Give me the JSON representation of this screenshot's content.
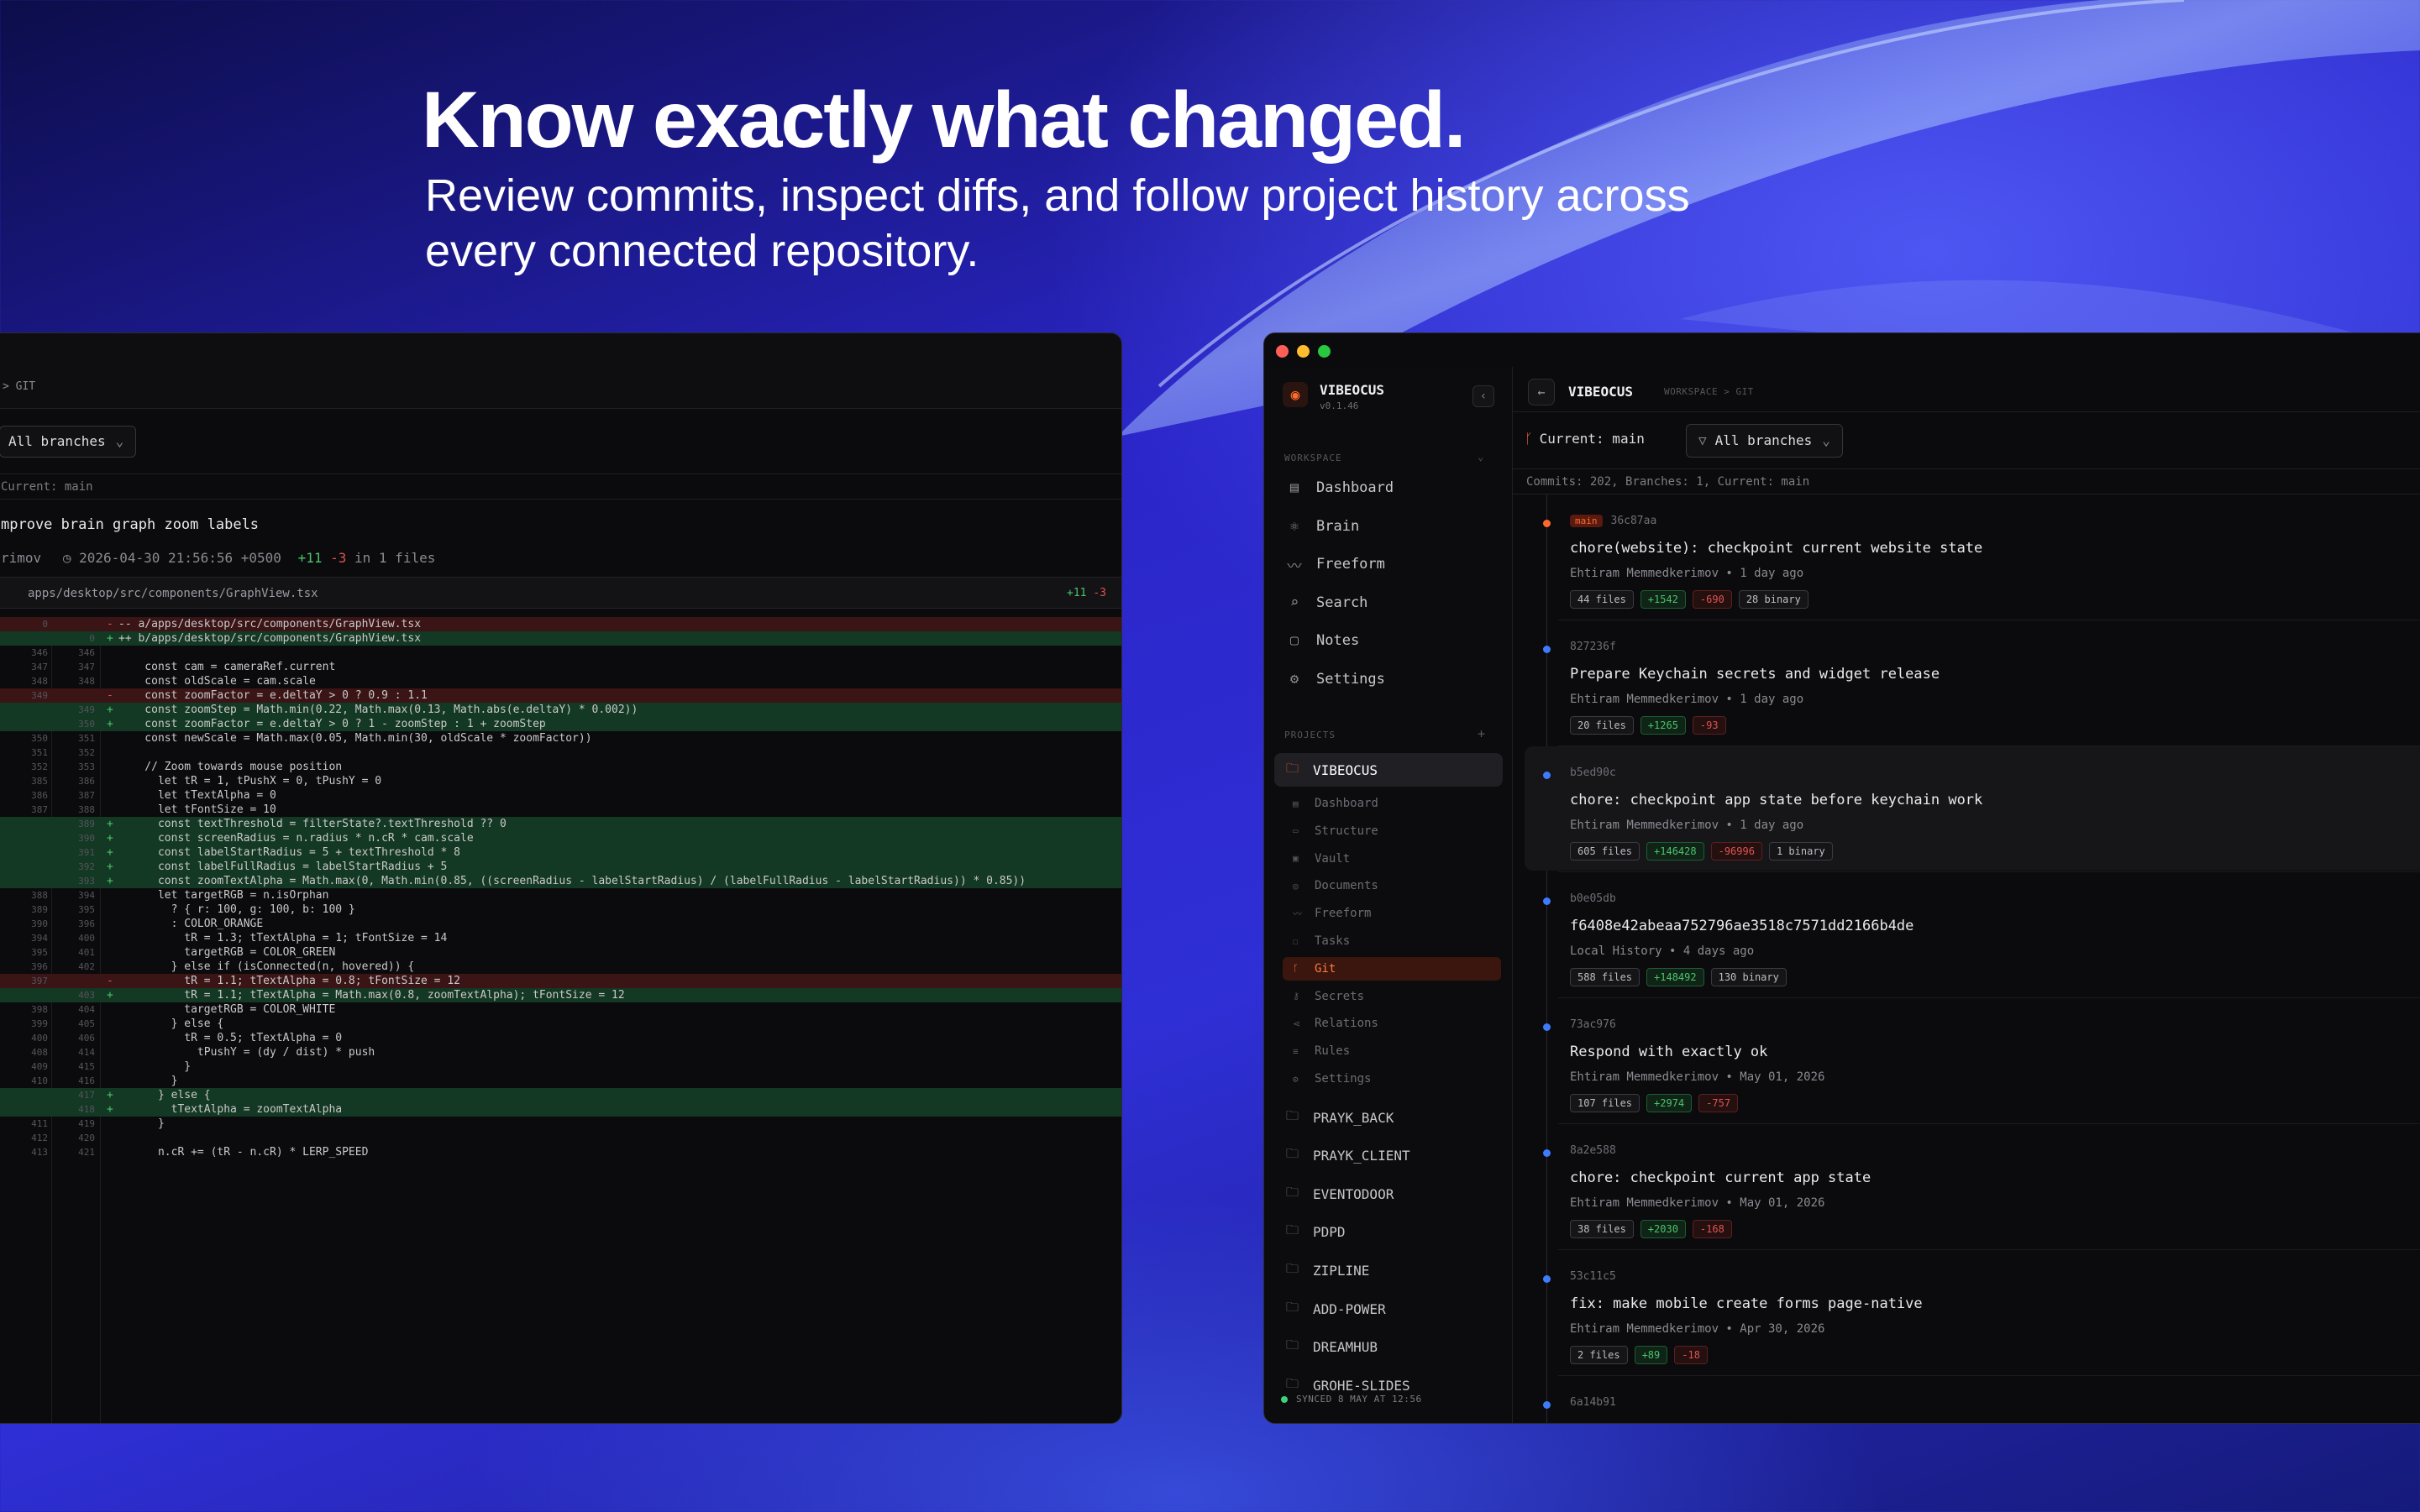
{
  "hero": {
    "headline": "Know exactly what changed.",
    "subline": "Review commits, inspect diffs, and follow project history across every connected repository."
  },
  "left_window": {
    "breadcrumb": "> GIT",
    "branches_label": "All branches",
    "meta": "Current: main",
    "commit_title": "mprove brain graph zoom labels",
    "commit_author": "rimov",
    "commit_date": "2026-04-30 21:56:56 +0500",
    "commit_plus": "+11",
    "commit_minus": "-3",
    "commit_files": "in 1 files",
    "file_path": "apps/desktop/src/components/GraphView.tsx",
    "file_plus": "+11",
    "file_minus": "-3",
    "diff_lines": [
      {
        "t": "del",
        "a": "0",
        "b": "",
        "s": "-",
        "c": "-- a/apps/desktop/src/components/GraphView.tsx"
      },
      {
        "t": "add",
        "a": "",
        "b": "0",
        "s": "+",
        "c": "++ b/apps/desktop/src/components/GraphView.tsx"
      },
      {
        "t": "ctx",
        "a": "346",
        "b": "346",
        "s": "",
        "c": ""
      },
      {
        "t": "ctx",
        "a": "347",
        "b": "347",
        "s": "",
        "c": "    const cam = cameraRef.current"
      },
      {
        "t": "ctx",
        "a": "348",
        "b": "348",
        "s": "",
        "c": "    const oldScale = cam.scale"
      },
      {
        "t": "del",
        "a": "349",
        "b": "",
        "s": "-",
        "c": "    const zoomFactor = e.deltaY > 0 ? 0.9 : 1.1"
      },
      {
        "t": "add",
        "a": "",
        "b": "349",
        "s": "+",
        "c": "    const zoomStep = Math.min(0.22, Math.max(0.13, Math.abs(e.deltaY) * 0.002))"
      },
      {
        "t": "add",
        "a": "",
        "b": "350",
        "s": "+",
        "c": "    const zoomFactor = e.deltaY > 0 ? 1 - zoomStep : 1 + zoomStep"
      },
      {
        "t": "ctx",
        "a": "350",
        "b": "351",
        "s": "",
        "c": "    const newScale = Math.max(0.05, Math.min(30, oldScale * zoomFactor))"
      },
      {
        "t": "ctx",
        "a": "351",
        "b": "352",
        "s": "",
        "c": ""
      },
      {
        "t": "ctx",
        "a": "352",
        "b": "353",
        "s": "",
        "c": "    // Zoom towards mouse position"
      },
      {
        "t": "ctx",
        "a": "385",
        "b": "386",
        "s": "",
        "c": "      let tR = 1, tPushX = 0, tPushY = 0"
      },
      {
        "t": "ctx",
        "a": "386",
        "b": "387",
        "s": "",
        "c": "      let tTextAlpha = 0"
      },
      {
        "t": "ctx",
        "a": "387",
        "b": "388",
        "s": "",
        "c": "      let tFontSize = 10"
      },
      {
        "t": "add",
        "a": "",
        "b": "389",
        "s": "+",
        "c": "      const textThreshold = filterState?.textThreshold ?? 0"
      },
      {
        "t": "add",
        "a": "",
        "b": "390",
        "s": "+",
        "c": "      const screenRadius = n.radius * n.cR * cam.scale"
      },
      {
        "t": "add",
        "a": "",
        "b": "391",
        "s": "+",
        "c": "      const labelStartRadius = 5 + textThreshold * 8"
      },
      {
        "t": "add",
        "a": "",
        "b": "392",
        "s": "+",
        "c": "      const labelFullRadius = labelStartRadius + 5"
      },
      {
        "t": "add",
        "a": "",
        "b": "393",
        "s": "+",
        "c": "      const zoomTextAlpha = Math.max(0, Math.min(0.85, ((screenRadius - labelStartRadius) / (labelFullRadius - labelStartRadius)) * 0.85))"
      },
      {
        "t": "ctx",
        "a": "388",
        "b": "394",
        "s": "",
        "c": "      let targetRGB = n.isOrphan"
      },
      {
        "t": "ctx",
        "a": "389",
        "b": "395",
        "s": "",
        "c": "        ? { r: 100, g: 100, b: 100 }"
      },
      {
        "t": "ctx",
        "a": "390",
        "b": "396",
        "s": "",
        "c": "        : COLOR_ORANGE"
      },
      {
        "t": "ctx",
        "a": "394",
        "b": "400",
        "s": "",
        "c": "          tR = 1.3; tTextAlpha = 1; tFontSize = 14"
      },
      {
        "t": "ctx",
        "a": "395",
        "b": "401",
        "s": "",
        "c": "          targetRGB = COLOR_GREEN"
      },
      {
        "t": "ctx",
        "a": "396",
        "b": "402",
        "s": "",
        "c": "        } else if (isConnected(n, hovered)) {"
      },
      {
        "t": "del",
        "a": "397",
        "b": "",
        "s": "-",
        "c": "          tR = 1.1; tTextAlpha = 0.8; tFontSize = 12"
      },
      {
        "t": "add",
        "a": "",
        "b": "403",
        "s": "+",
        "c": "          tR = 1.1; tTextAlpha = Math.max(0.8, zoomTextAlpha); tFontSize = 12"
      },
      {
        "t": "ctx",
        "a": "398",
        "b": "404",
        "s": "",
        "c": "          targetRGB = COLOR_WHITE"
      },
      {
        "t": "ctx",
        "a": "399",
        "b": "405",
        "s": "",
        "c": "        } else {"
      },
      {
        "t": "ctx",
        "a": "400",
        "b": "406",
        "s": "",
        "c": "          tR = 0.5; tTextAlpha = 0"
      },
      {
        "t": "ctx",
        "a": "408",
        "b": "414",
        "s": "",
        "c": "            tPushY = (dy / dist) * push"
      },
      {
        "t": "ctx",
        "a": "409",
        "b": "415",
        "s": "",
        "c": "          }"
      },
      {
        "t": "ctx",
        "a": "410",
        "b": "416",
        "s": "",
        "c": "        }"
      },
      {
        "t": "add",
        "a": "",
        "b": "417",
        "s": "+",
        "c": "      } else {"
      },
      {
        "t": "add",
        "a": "",
        "b": "418",
        "s": "+",
        "c": "        tTextAlpha = zoomTextAlpha"
      },
      {
        "t": "ctx",
        "a": "411",
        "b": "419",
        "s": "",
        "c": "      }"
      },
      {
        "t": "ctx",
        "a": "412",
        "b": "420",
        "s": "",
        "c": ""
      },
      {
        "t": "ctx",
        "a": "413",
        "b": "421",
        "s": "",
        "c": "      n.cR += (tR - n.cR) * LERP_SPEED"
      }
    ]
  },
  "right_window": {
    "app": {
      "name": "VIBEOCUS",
      "version": "v0.1.46",
      "logo_icon": "eye-icon"
    },
    "sidebar": {
      "workspace_label": "WORKSPACE",
      "nav": [
        {
          "label": "Dashboard",
          "icon": "dashboard-icon",
          "glyph": "▤"
        },
        {
          "label": "Brain",
          "icon": "brain-icon",
          "glyph": "⚛"
        },
        {
          "label": "Freeform",
          "icon": "freeform-icon",
          "glyph": "〰"
        },
        {
          "label": "Search",
          "icon": "search-icon",
          "glyph": "⌕"
        },
        {
          "label": "Notes",
          "icon": "notes-icon",
          "glyph": "▢"
        },
        {
          "label": "Settings",
          "icon": "gear-icon",
          "glyph": "⚙"
        }
      ],
      "projects_label": "PROJECTS",
      "projects_add": "+",
      "active_project": "VIBEOCUS",
      "sub_items": [
        {
          "label": "Dashboard",
          "icon": "dashboard-icon",
          "glyph": "▤",
          "active": false
        },
        {
          "label": "Structure",
          "icon": "folder-icon",
          "glyph": "▭",
          "active": false
        },
        {
          "label": "Vault",
          "icon": "vault-icon",
          "glyph": "▣",
          "active": false
        },
        {
          "label": "Documents",
          "icon": "document-icon",
          "glyph": "◎",
          "active": false
        },
        {
          "label": "Freeform",
          "icon": "freeform-icon",
          "glyph": "〰",
          "active": false
        },
        {
          "label": "Tasks",
          "icon": "tasks-icon",
          "glyph": "☐",
          "active": false
        },
        {
          "label": "Git",
          "icon": "git-branch-icon",
          "glyph": "ᚴ",
          "active": true
        },
        {
          "label": "Secrets",
          "icon": "key-icon",
          "glyph": "⚷",
          "active": false
        },
        {
          "label": "Relations",
          "icon": "relations-icon",
          "glyph": "⋖",
          "active": false
        },
        {
          "label": "Rules",
          "icon": "rules-icon",
          "glyph": "≡",
          "active": false
        },
        {
          "label": "Settings",
          "icon": "gear-icon",
          "glyph": "⚙",
          "active": false
        }
      ],
      "projects": [
        "PRAYK_BACK",
        "PRAYK_CLIENT",
        "EVENTODOOR",
        "PDPD",
        "ZIPLINE",
        "ADD-POWER",
        "DREAMHUB",
        "GROHE-SLIDES"
      ],
      "sync_status": "SYNCED 8 MAY AT 12:56"
    },
    "header": {
      "title": "VIBEOCUS",
      "breadcrumb": "WORKSPACE > GIT"
    },
    "toolbar": {
      "current_branch": "Current: main",
      "branches_label": "All branches"
    },
    "meta": "Commits: 202, Branches: 1, Current: main",
    "commits": [
      {
        "hash": "36c87aa",
        "branch": "main",
        "message": "chore(website): checkpoint current website state",
        "author": "Ehtiram Memmedkerimov • 1 day ago",
        "files": "44 files",
        "plus": "+1542",
        "minus": "-690",
        "binary": "28 binary",
        "selected": false
      },
      {
        "hash": "827236f",
        "branch": "",
        "message": "Prepare Keychain secrets and widget release",
        "author": "Ehtiram Memmedkerimov • 1 day ago",
        "files": "20 files",
        "plus": "+1265",
        "minus": "-93",
        "binary": "",
        "selected": false
      },
      {
        "hash": "b5ed90c",
        "branch": "",
        "message": "chore: checkpoint app state before keychain work",
        "author": "Ehtiram Memmedkerimov • 1 day ago",
        "files": "605 files",
        "plus": "+146428",
        "minus": "-96996",
        "binary": "1 binary",
        "selected": true
      },
      {
        "hash": "b0e05db",
        "branch": "",
        "message": "f6408e42abeaa752796ae3518c7571dd2166b4de",
        "author": "Local History • 4 days ago",
        "files": "588 files",
        "plus": "+148492",
        "minus": "",
        "binary": "130 binary",
        "selected": false
      },
      {
        "hash": "73ac976",
        "branch": "",
        "message": "Respond with exactly ok",
        "author": "Ehtiram Memmedkerimov • May 01, 2026",
        "files": "107 files",
        "plus": "+2974",
        "minus": "-757",
        "binary": "",
        "selected": false
      },
      {
        "hash": "8a2e588",
        "branch": "",
        "message": "chore: checkpoint current app state",
        "author": "Ehtiram Memmedkerimov • May 01, 2026",
        "files": "38 files",
        "plus": "+2030",
        "minus": "-168",
        "binary": "",
        "selected": false
      },
      {
        "hash": "53c11c5",
        "branch": "",
        "message": "fix: make mobile create forms page-native",
        "author": "Ehtiram Memmedkerimov • Apr 30, 2026",
        "files": "2 files",
        "plus": "+89",
        "minus": "-18",
        "binary": "",
        "selected": false
      },
      {
        "hash": "6a14b91",
        "branch": "",
        "message": "",
        "author": "",
        "files": "",
        "plus": "",
        "minus": "",
        "binary": "",
        "selected": false
      }
    ],
    "colors": {
      "accent": "#ff6a2a",
      "add": "#4cc36a",
      "del": "#e05252",
      "timeline_dot": "#3d7bff"
    }
  }
}
